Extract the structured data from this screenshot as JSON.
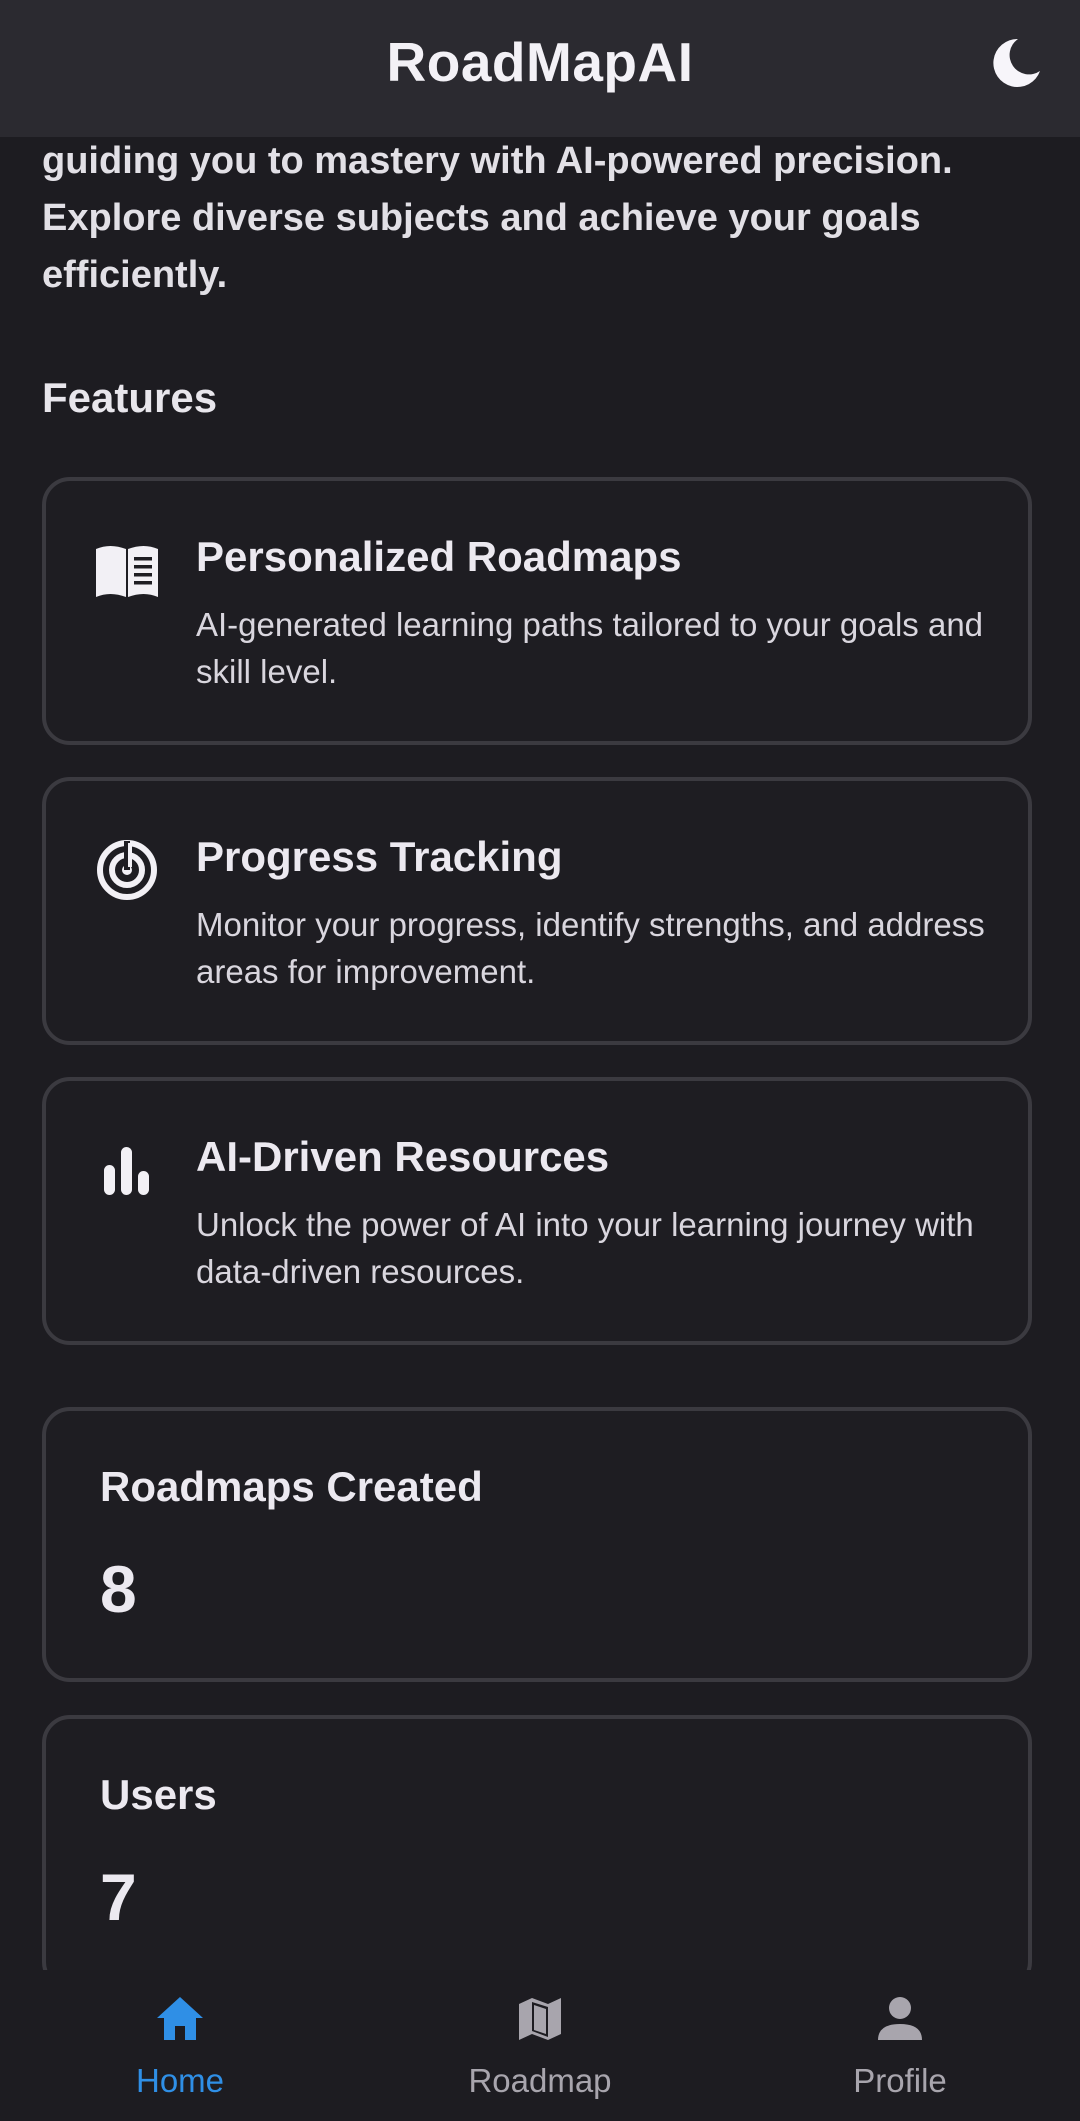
{
  "app_bar": {
    "title": "RoadMapAI",
    "theme_icon": "moon-icon"
  },
  "intro": {
    "text": "guiding you to mastery with AI-powered precision. Explore diverse subjects and achieve your goals efficiently."
  },
  "features": {
    "title": "Features",
    "items": [
      {
        "icon": "book-icon",
        "title": "Personalized Roadmaps",
        "description": "AI-generated learning paths tailored to your goals and skill level."
      },
      {
        "icon": "target-icon",
        "title": "Progress Tracking",
        "description": "Monitor your progress, identify strengths, and address areas for improvement."
      },
      {
        "icon": "bar-chart-icon",
        "title": "AI-Driven Resources",
        "description": "Unlock the power of AI into your learning journey with data-driven resources."
      }
    ]
  },
  "stats": [
    {
      "label": "Roadmaps Created",
      "value": "8"
    },
    {
      "label": "Users",
      "value": "7"
    }
  ],
  "bottom_nav": {
    "items": [
      {
        "label": "Home",
        "icon": "home-icon",
        "active": true
      },
      {
        "label": "Roadmap",
        "icon": "map-icon",
        "active": false
      },
      {
        "label": "Profile",
        "icon": "person-icon",
        "active": false
      }
    ]
  },
  "colors": {
    "background": "#1d1c21",
    "app_bar": "#2b2a30",
    "card_border": "#3b3a40",
    "accent": "#2f8fe6",
    "inactive_nav": "#a8a5ad"
  }
}
